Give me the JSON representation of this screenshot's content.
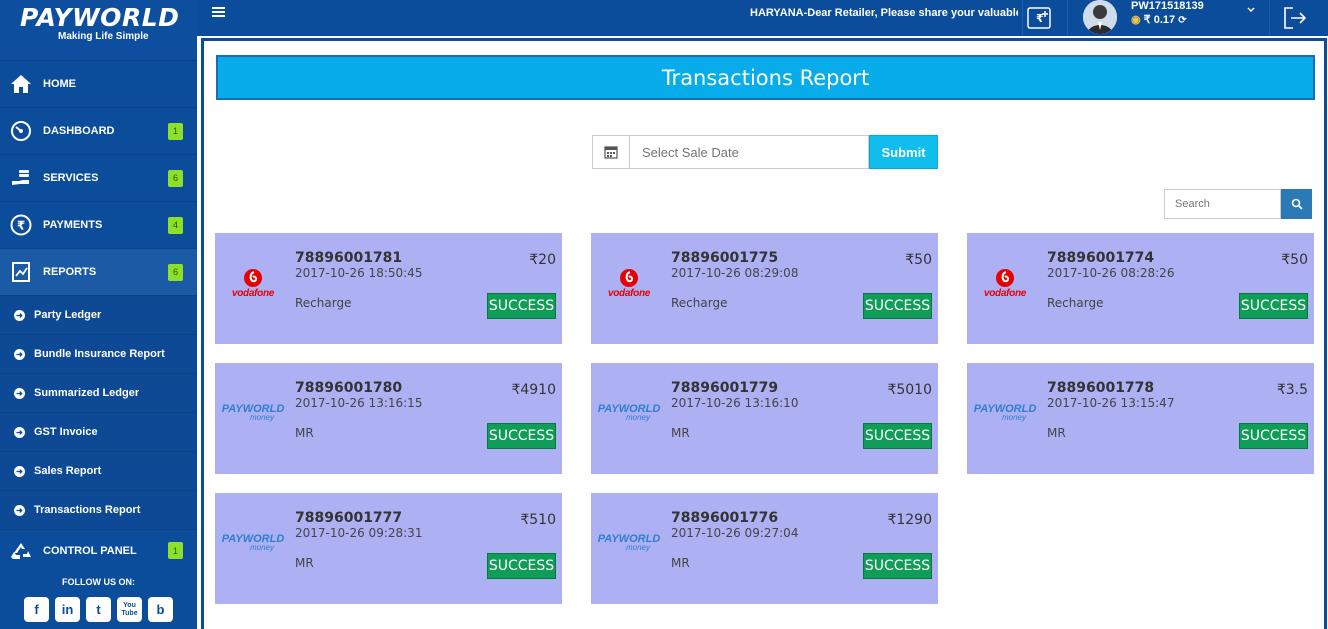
{
  "brand": {
    "name": "PAYWORLD",
    "tagline": "Making Life Simple"
  },
  "sidebar": {
    "items": [
      {
        "label": "HOME",
        "icon": "home-icon",
        "badge": ""
      },
      {
        "label": "DASHBOARD",
        "icon": "speedometer-icon",
        "badge": "1"
      },
      {
        "label": "SERVICES",
        "icon": "hand-coins-icon",
        "badge": "6"
      },
      {
        "label": "PAYMENTS",
        "icon": "rupee-circle-icon",
        "badge": "4"
      },
      {
        "label": "REPORTS",
        "icon": "chart-doc-icon",
        "badge": "6"
      }
    ],
    "sub_items": [
      "Party Ledger",
      "Bundle Insurance Report",
      "Summarized Ledger",
      "GST Invoice",
      "Sales Report",
      "Transactions Report"
    ],
    "control_panel": {
      "label": "CONTROL PANEL",
      "badge": "1",
      "icon": "recycle-icon"
    },
    "follow_label": "FOLLOW US ON:",
    "socials": [
      "f",
      "in",
      "t",
      "You Tube",
      "b"
    ]
  },
  "header": {
    "marquee": "HARYANA-Dear Retailer, Please share your valuable fee",
    "user_id": "PW171518139",
    "balance": "₹ 0.17"
  },
  "main": {
    "title": "Transactions Report",
    "date_placeholder": "Select Sale Date",
    "submit_label": "Submit",
    "search_placeholder": "Search",
    "transactions": [
      {
        "id": "78896001781",
        "datetime": "2017-10-26 18:50:45",
        "amount": "₹20",
        "type": "Recharge",
        "status": "SUCCESS",
        "logo": "vodafone"
      },
      {
        "id": "78896001775",
        "datetime": "2017-10-26 08:29:08",
        "amount": "₹50",
        "type": "Recharge",
        "status": "SUCCESS",
        "logo": "vodafone"
      },
      {
        "id": "78896001774",
        "datetime": "2017-10-26 08:28:26",
        "amount": "₹50",
        "type": "Recharge",
        "status": "SUCCESS",
        "logo": "vodafone"
      },
      {
        "id": "78896001780",
        "datetime": "2017-10-26 13:16:15",
        "amount": "₹4910",
        "type": "MR",
        "status": "SUCCESS",
        "logo": "payworld"
      },
      {
        "id": "78896001779",
        "datetime": "2017-10-26 13:16:10",
        "amount": "₹5010",
        "type": "MR",
        "status": "SUCCESS",
        "logo": "payworld"
      },
      {
        "id": "78896001778",
        "datetime": "2017-10-26 13:15:47",
        "amount": "₹3.5",
        "type": "MR",
        "status": "SUCCESS",
        "logo": "payworld"
      },
      {
        "id": "78896001777",
        "datetime": "2017-10-26 09:28:31",
        "amount": "₹510",
        "type": "MR",
        "status": "SUCCESS",
        "logo": "payworld"
      },
      {
        "id": "78896001776",
        "datetime": "2017-10-26 09:27:04",
        "amount": "₹1290",
        "type": "MR",
        "status": "SUCCESS",
        "logo": "payworld"
      }
    ],
    "logos": {
      "vodafone": {
        "word": "vodafone"
      },
      "payworld": {
        "word": "PAYWORLD",
        "sub": "money"
      }
    }
  },
  "colors": {
    "sidebar": "#0b4d9b",
    "title_bar": "#08acea",
    "card": "#aeb0f4",
    "success": "#0f9d58",
    "badge": "#8de02a"
  }
}
